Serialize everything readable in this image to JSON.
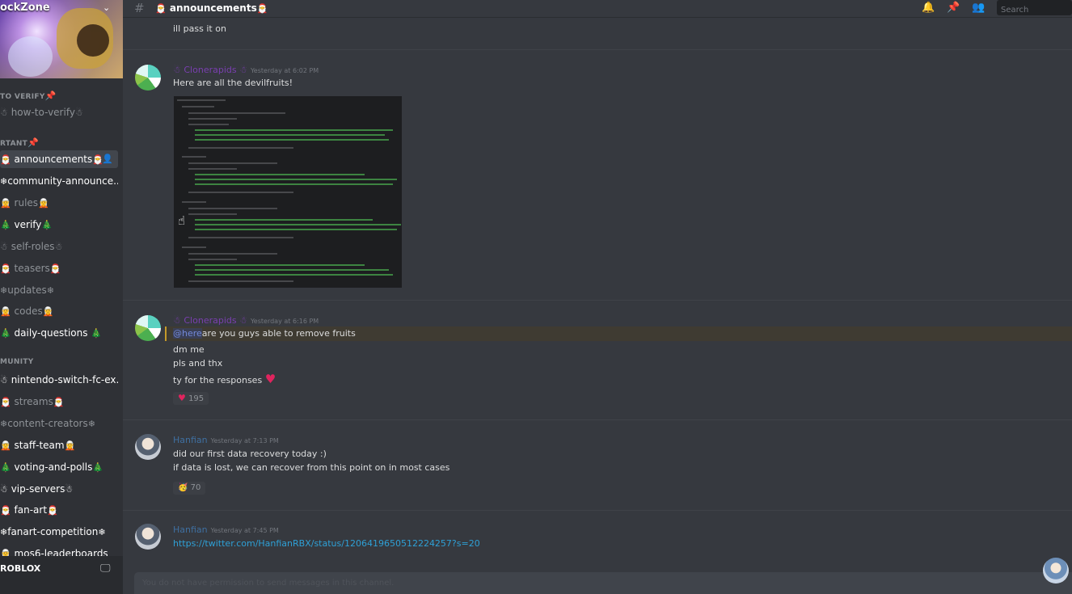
{
  "server": {
    "name": "ockZone"
  },
  "sidebar": {
    "categories": {
      "verify": "TO VERIFY",
      "important": "RTANT",
      "community": "MUNITY"
    },
    "channels": [
      {
        "label": "how-to-verify"
      },
      {
        "label": "announcements"
      },
      {
        "label": "community-announce..."
      },
      {
        "label": "rules"
      },
      {
        "label": "verify"
      },
      {
        "label": "self-roles"
      },
      {
        "label": "teasers"
      },
      {
        "label": "updates"
      },
      {
        "label": "codes"
      },
      {
        "label": "daily-questions"
      },
      {
        "label": "nintendo-switch-fc-ex..."
      },
      {
        "label": "streams"
      },
      {
        "label": "content-creators"
      },
      {
        "label": "staff-team"
      },
      {
        "label": "voting-and-polls"
      },
      {
        "label": "vip-servers"
      },
      {
        "label": "fan-art"
      },
      {
        "label": "fanart-competition"
      },
      {
        "label": "mos6-leaderboards"
      }
    ],
    "footer": {
      "label": "ROBLOX"
    }
  },
  "header": {
    "channel_title": "announcements",
    "search_placeholder": "Search"
  },
  "messages": {
    "prev_line": "ill pass it on",
    "m1": {
      "author": "Clonerapids",
      "time": "Yesterday at 6:02 PM",
      "text": "Here are all the devilfruits!"
    },
    "m2": {
      "author": "Clonerapids",
      "time": "Yesterday at 6:16 PM",
      "mention": "@here",
      "line1": "are you guys able to remove fruits",
      "line2": "dm me",
      "line3": "pls and thx",
      "line4": "ty for the responses",
      "reaction_count": "195"
    },
    "m3": {
      "author": "Hanfian",
      "time": "Yesterday at 7:13 PM",
      "line1": "did our first data recovery today :)",
      "line2": "if data is lost, we can recover from this point on in most cases",
      "reaction_count": "70"
    },
    "m4": {
      "author": "Hanfian",
      "time": "Yesterday at 7:45 PM",
      "link": "https://twitter.com/HanfianRBX/status/1206419650512224257?s=20"
    }
  },
  "composer": {
    "text": "You do not have permission to send messages in this channel."
  },
  "colors": {
    "background": "#36393f",
    "sidebar": "#2f3136",
    "mention_bg": "#3f3b32",
    "link": "#2ea0d6"
  }
}
